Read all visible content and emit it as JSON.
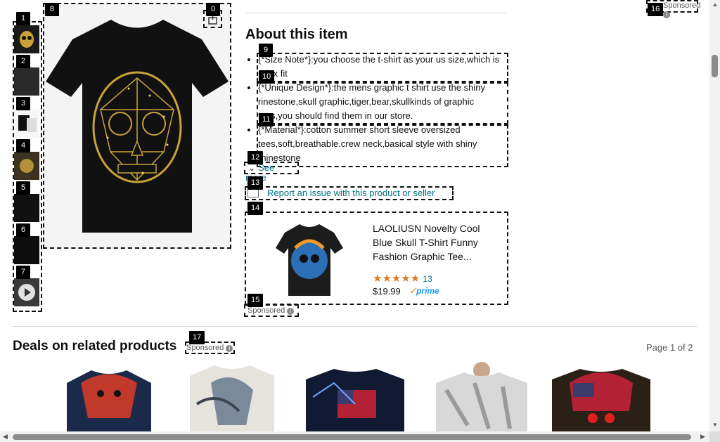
{
  "gallery": {
    "thumbs": [
      "1",
      "2",
      "3",
      "4",
      "5",
      "6",
      "7"
    ]
  },
  "badges": {
    "b0": "0",
    "b1": "1",
    "b2": "2",
    "b3": "3",
    "b4": "4",
    "b5": "5",
    "b6": "6",
    "b7": "7",
    "b8": "8",
    "b9": "9",
    "b10": "10",
    "b11": "11",
    "b12": "12",
    "b13": "13",
    "b14": "14",
    "b15": "15",
    "b16": "16",
    "b17": "17"
  },
  "header": {
    "sponsored_top": "Sponsored"
  },
  "about": {
    "title": "About this item",
    "bullets": [
      "{*Size Note*}:you choose the t-shirt as your us size,which is relax fit",
      "{*Unique Design*}:the mens graphic t shirt use the shiny rinestone,skull graphic,tiger,bear,skullkinds of graphic tees,you should find them in our store.",
      "{*Material*}:cotton summer short sleeve oversized tees,soft,breathable.crew neck,basical style with shiny rhinestone"
    ],
    "see_more": "See more",
    "report": "Report an issue with this product or seller"
  },
  "sponsored_product": {
    "title": "LAOLIUSN Novelty Cool Blue Skull T-Shirt Funny Fashion Graphic Tee...",
    "rating_count": "13",
    "price": "$19.99",
    "prime": "prime",
    "sponsored": "Sponsored"
  },
  "deals": {
    "title": "Deals on related products",
    "sponsored": "Sponsored",
    "page": "Page 1 of 2"
  },
  "colors": {
    "link": "#007185",
    "star": "#de7921",
    "prime": "#1a98ff"
  }
}
